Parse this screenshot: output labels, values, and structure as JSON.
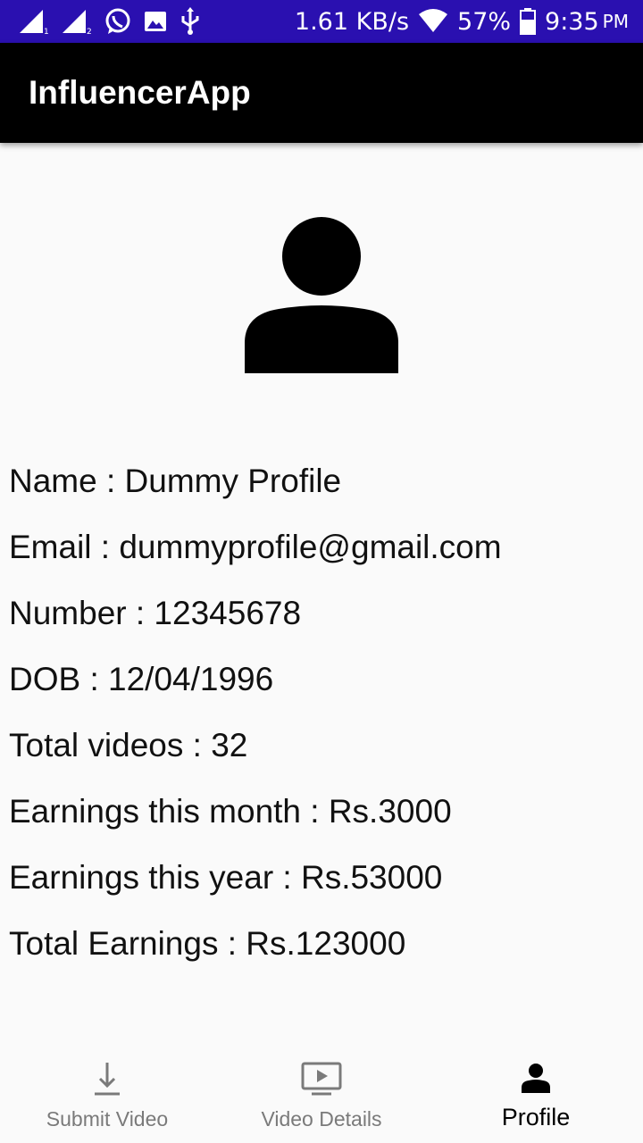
{
  "status_bar": {
    "network_speed": "1.61 KB/s",
    "battery_percent": "57%",
    "time": "9:35",
    "ampm": "PM",
    "icons": [
      "signal-sim1-icon",
      "signal-sim2-icon",
      "whatsapp-icon",
      "gallery-icon",
      "usb-icon",
      "wifi-icon",
      "battery-icon"
    ]
  },
  "app_bar": {
    "title": "InfluencerApp"
  },
  "profile": {
    "avatar_icon": "person-icon",
    "rows": [
      "Name : Dummy Profile",
      "Email : dummyprofile@gmail.com",
      "Number : 12345678",
      "DOB : 12/04/1996",
      "Total videos : 32",
      "Earnings this month : Rs.3000",
      "Earnings this year : Rs.53000",
      "Total Earnings : Rs.123000"
    ]
  },
  "bottom_nav": {
    "items": [
      {
        "label": "Submit Video",
        "icon": "download-icon",
        "active": false
      },
      {
        "label": "Video Details",
        "icon": "video-screen-icon",
        "active": false
      },
      {
        "label": "Profile",
        "icon": "person-icon",
        "active": true
      }
    ]
  },
  "colors": {
    "status_bar": "#2a10b0",
    "app_bar": "#000000",
    "background": "#fafafa",
    "nav_inactive": "#7a7a7a",
    "nav_active": "#000000"
  }
}
